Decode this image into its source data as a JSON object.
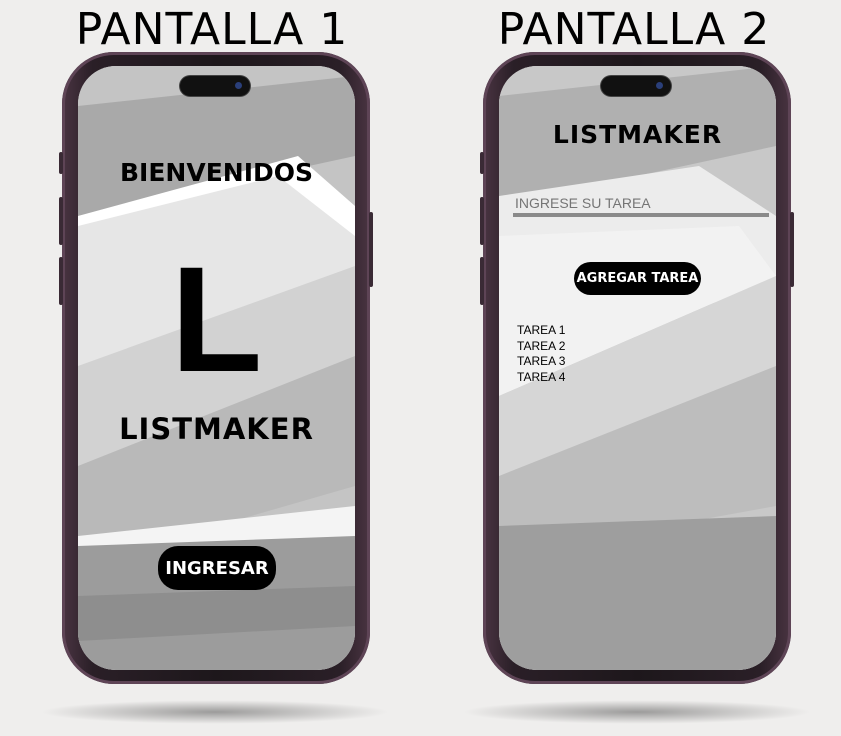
{
  "screens": [
    {
      "title": "PANTALLA 1",
      "welcome": "BIENVENIDOS",
      "logo_letter": "L",
      "app_name": "LISTMAKER",
      "enter_button": "INGRESAR"
    },
    {
      "title": "PANTALLA 2",
      "app_name": "LISTMAKER",
      "task_input": {
        "value": "",
        "placeholder": "INGRESE SU TAREA"
      },
      "add_button": "AGREGAR TAREA",
      "tasks": [
        "TAREA 1",
        "TAREA 2",
        "TAREA 3",
        "TAREA 4"
      ]
    }
  ],
  "colors": {
    "button": "#000000",
    "phone_frame": "#2a1f27",
    "input_underline": "#8a8a8a"
  }
}
